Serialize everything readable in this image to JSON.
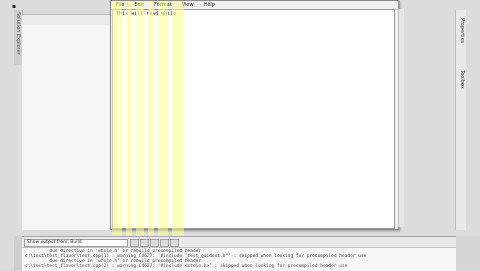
{
  "notepad": {
    "menu": [
      "File",
      "Edit",
      "Format",
      "View",
      "Help"
    ],
    "first_line": "This will read while"
  },
  "output": {
    "select_value": "Show output from: Build",
    "lines": [
      "         due directive in 'whole.h' or rebuild precompiled header",
      "c:\\test\\test_flavor\\test.cpp(1) : warning C4627: '#include \"test_guidest.h\"' : skipped when looking for precompiled header use",
      "         due directive in 'whole.h' or rebuild precompiled header",
      "c:\\test\\test_flavor\\test.cpp(2) : warning C4627: '#include <stdio.h>' : skipped when looking for precompiled header use"
    ]
  },
  "sidebar": {
    "left_label": "Solution Explorer",
    "right_label": "Properties",
    "right_label2": "Toolbox"
  },
  "colors": {
    "highlight": "#ffff8c",
    "editor_bg": "#ffffff",
    "window_bg": "#f0f0f0"
  }
}
